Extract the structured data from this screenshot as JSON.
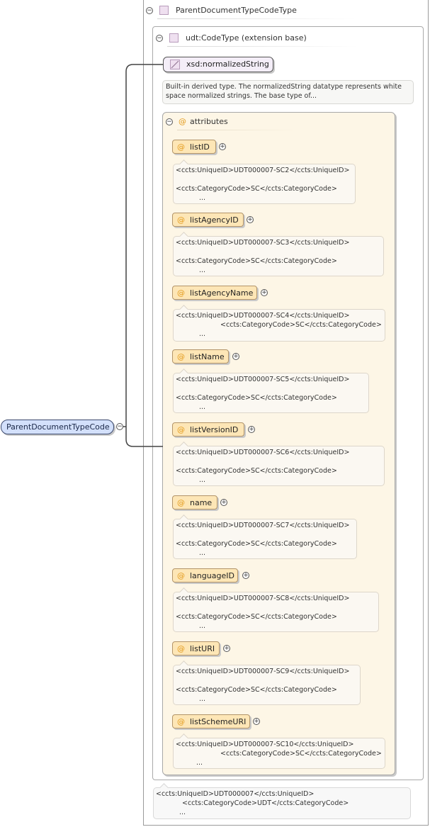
{
  "root_type": "ParentDocumentTypeCodeType",
  "extension_base": "udt:CodeType (extension base)",
  "base_type": "xsd:normalizedString",
  "base_doc": [
    "Built-in derived type. The normalizedString datatype represents white",
    "space normalized strings. The base type of..."
  ],
  "attributes_label": "attributes",
  "element_name": "ParentDocumentTypeCode",
  "attributes": [
    {
      "name": "listID",
      "uid": "<ccts:UniqueID>UDT000007-SC2</ccts:UniqueID>",
      "cat": "<ccts:CategoryCode>SC</ccts:CategoryCode>",
      "more": "..."
    },
    {
      "name": "listAgencyID",
      "uid": "<ccts:UniqueID>UDT000007-SC3</ccts:UniqueID>",
      "cat": "<ccts:CategoryCode>SC</ccts:CategoryCode>",
      "more": "..."
    },
    {
      "name": "listAgencyName",
      "uid": "<ccts:UniqueID>UDT000007-SC4</ccts:UniqueID>",
      "cat": "<ccts:CategoryCode>SC</ccts:CategoryCode>",
      "more": "..."
    },
    {
      "name": "listName",
      "uid": "<ccts:UniqueID>UDT000007-SC5</ccts:UniqueID>",
      "cat": "<ccts:CategoryCode>SC</ccts:CategoryCode>",
      "more": "..."
    },
    {
      "name": "listVersionID",
      "uid": "<ccts:UniqueID>UDT000007-SC6</ccts:UniqueID>",
      "cat": "<ccts:CategoryCode>SC</ccts:CategoryCode>",
      "more": "..."
    },
    {
      "name": "name",
      "uid": "<ccts:UniqueID>UDT000007-SC7</ccts:UniqueID>",
      "cat": "<ccts:CategoryCode>SC</ccts:CategoryCode>",
      "more": "..."
    },
    {
      "name": "languageID",
      "uid": "<ccts:UniqueID>UDT000007-SC8</ccts:UniqueID>",
      "cat": "<ccts:CategoryCode>SC</ccts:CategoryCode>",
      "more": "..."
    },
    {
      "name": "listURI",
      "uid": "<ccts:UniqueID>UDT000007-SC9</ccts:UniqueID>",
      "cat": "<ccts:CategoryCode>SC</ccts:CategoryCode>",
      "more": "..."
    },
    {
      "name": "listSchemeURI",
      "uid": "<ccts:UniqueID>UDT000007-SC10</ccts:UniqueID>",
      "cat": "<ccts:CategoryCode>SC</ccts:CategoryCode>",
      "more": "..."
    }
  ],
  "bottom_doc": {
    "uid": "<ccts:UniqueID>UDT000007</ccts:UniqueID>",
    "cat": "<ccts:CategoryCode>UDT</ccts:CategoryCode>",
    "more": "..."
  }
}
